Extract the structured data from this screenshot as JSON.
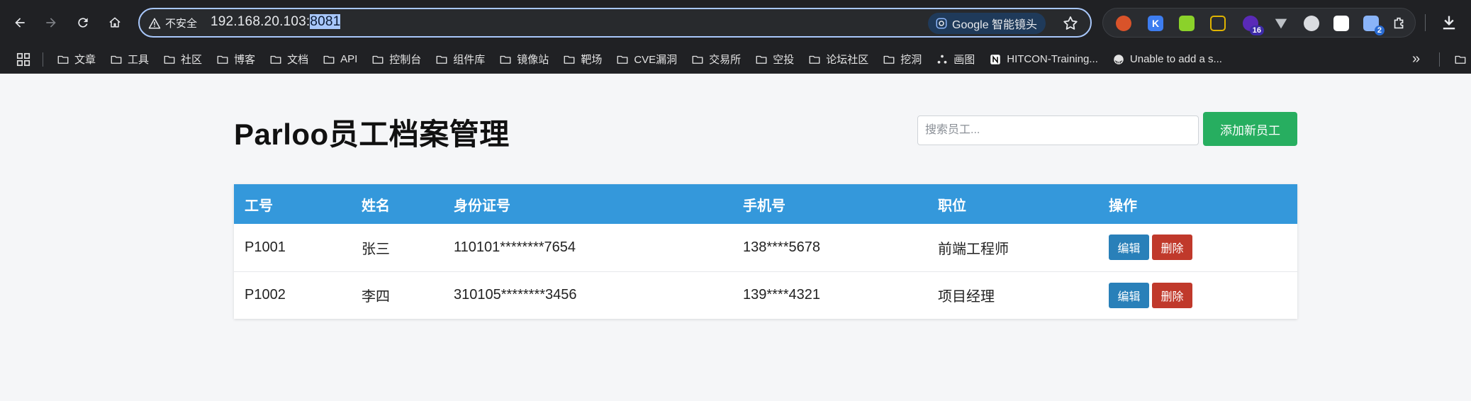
{
  "browser": {
    "security_label": "不安全",
    "url_main": "192.168.20.103:",
    "url_selected": "8081",
    "lens_label": "Google 智能镜头",
    "ext_badges": [
      "16",
      "2"
    ]
  },
  "bookmarks": [
    {
      "label": "文章",
      "icon": "folder-icon"
    },
    {
      "label": "工具",
      "icon": "folder-icon"
    },
    {
      "label": "社区",
      "icon": "folder-icon"
    },
    {
      "label": "博客",
      "icon": "folder-icon"
    },
    {
      "label": "文档",
      "icon": "folder-icon"
    },
    {
      "label": "API",
      "icon": "folder-icon"
    },
    {
      "label": "控制台",
      "icon": "folder-icon"
    },
    {
      "label": "组件库",
      "icon": "folder-icon"
    },
    {
      "label": "镜像站",
      "icon": "folder-icon"
    },
    {
      "label": "靶场",
      "icon": "folder-icon"
    },
    {
      "label": "CVE漏洞",
      "icon": "folder-icon"
    },
    {
      "label": "交易所",
      "icon": "folder-icon"
    },
    {
      "label": "空投",
      "icon": "folder-icon"
    },
    {
      "label": "论坛社区",
      "icon": "folder-icon"
    },
    {
      "label": "挖洞",
      "icon": "folder-icon"
    },
    {
      "label": "画图",
      "icon": "graph-icon"
    },
    {
      "label": "HITCON-Training...",
      "icon": "notion-icon"
    },
    {
      "label": "Unable to add a s...",
      "icon": "github-icon"
    }
  ],
  "bookmarks_more": "»",
  "page": {
    "title": "Parloo员工档案管理",
    "search_placeholder": "搜索员工...",
    "add_button": "添加新员工"
  },
  "table": {
    "headers": [
      "工号",
      "姓名",
      "身份证号",
      "手机号",
      "职位",
      "操作"
    ],
    "rows": [
      {
        "id": "P1001",
        "name": "张三",
        "id_card": "110101********7654",
        "phone": "138****5678",
        "position": "前端工程师"
      },
      {
        "id": "P1002",
        "name": "李四",
        "id_card": "310105********3456",
        "phone": "139****4321",
        "position": "项目经理"
      }
    ],
    "edit_label": "编辑",
    "delete_label": "删除"
  },
  "colors": {
    "header_blue": "#3498db",
    "add_green": "#27ae60",
    "edit_blue": "#2980b9",
    "delete_red": "#c0392b"
  }
}
